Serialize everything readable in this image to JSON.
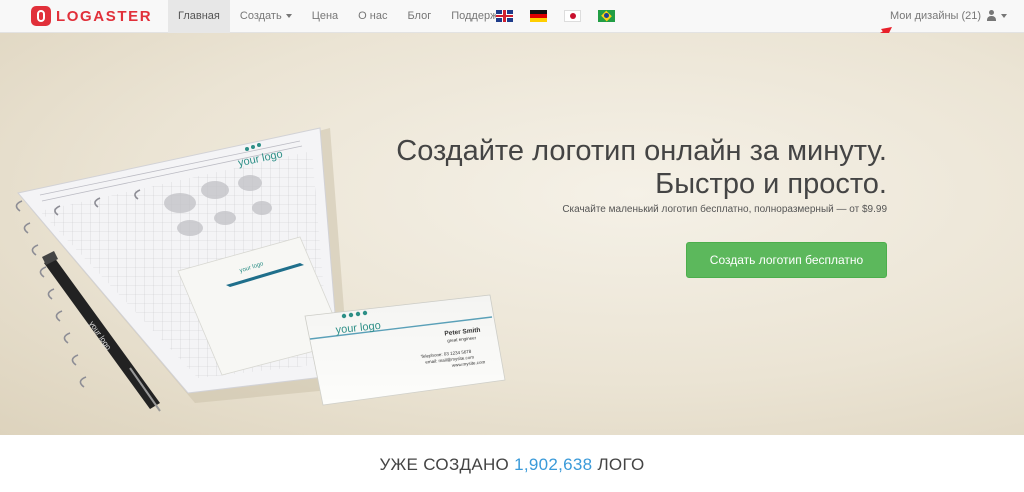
{
  "brand": {
    "name": "LOGASTER",
    "color": "#e1303a"
  },
  "nav": {
    "items": [
      {
        "label": "Главная",
        "active": true
      },
      {
        "label": "Создать",
        "dropdown": true
      },
      {
        "label": "Цена"
      },
      {
        "label": "О нас"
      },
      {
        "label": "Блог"
      },
      {
        "label": "Поддержка"
      }
    ],
    "languages": [
      "uk-flag-icon",
      "germany-flag-icon",
      "japan-flag-icon",
      "brazil-flag-icon"
    ],
    "my_designs": "Мои дизайны (21)"
  },
  "hero": {
    "title_line1": "Создайте логотип онлайн за минуту.",
    "title_line2": "Быстро и просто.",
    "subtitle": "Скачайте маленький логотип бесплатно, полноразмерный — от $9.99",
    "cta": "Создать логотип бесплатно",
    "cta_color": "#5cb85c",
    "mockup": {
      "notebook_logo": "your logo",
      "card_logo": "your logo",
      "card_name": "Peter Smith",
      "card_role": "great engineer",
      "card_phone": "Telephone: 03 1234 5678",
      "card_email": "email: mail@mysite.com",
      "card_site": "www.mysite.com",
      "pen_logo": "your logo"
    }
  },
  "stats": {
    "prefix": "УЖЕ СОЗДАНО",
    "count": "1,902,638",
    "suffix": "ЛОГО",
    "count_color": "#3a9ad9"
  }
}
